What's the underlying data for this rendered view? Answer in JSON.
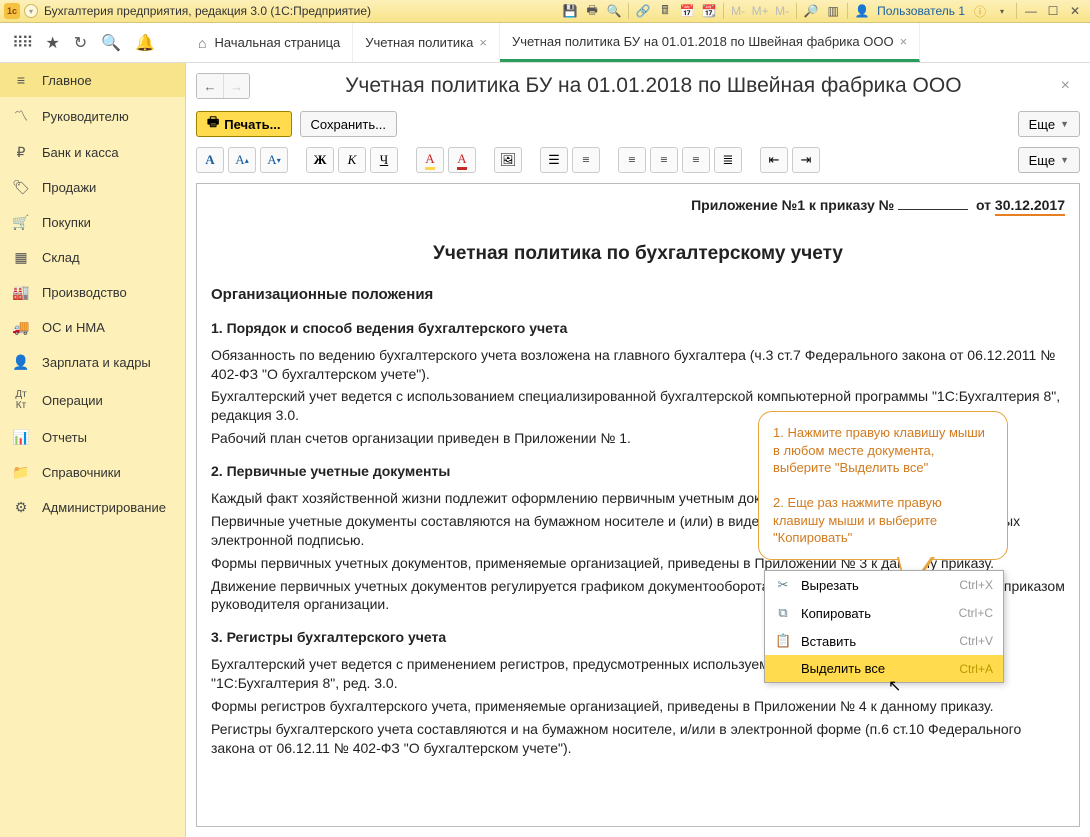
{
  "titlebar": {
    "title": "Бухгалтерия предприятия, редакция 3.0  (1С:Предприятие)",
    "user": "Пользователь 1"
  },
  "tabs": {
    "home": "Начальная страница",
    "t1": "Учетная политика",
    "t2": "Учетная политика БУ на 01.01.2018 по Швейная фабрика ООО"
  },
  "sidebar": {
    "items": [
      {
        "label": "Главное"
      },
      {
        "label": "Руководителю"
      },
      {
        "label": "Банк и касса"
      },
      {
        "label": "Продажи"
      },
      {
        "label": "Покупки"
      },
      {
        "label": "Склад"
      },
      {
        "label": "Производство"
      },
      {
        "label": "ОС и НМА"
      },
      {
        "label": "Зарплата и кадры"
      },
      {
        "label": "Операции"
      },
      {
        "label": "Отчеты"
      },
      {
        "label": "Справочники"
      },
      {
        "label": "Администрирование"
      }
    ]
  },
  "page": {
    "title": "Учетная политика БУ на 01.01.2018 по Швейная фабрика ООО",
    "print": "Печать...",
    "save": "Сохранить...",
    "more": "Еще"
  },
  "doc": {
    "annex_prefix": "Приложение №1 к приказу № ",
    "annex_from": "от ",
    "annex_date": "30.12.2017",
    "h2": "Учетная политика по бухгалтерскому учету",
    "h3_1": "Организационные положения",
    "h4_1": "1. Порядок и способ ведения бухгалтерского учета",
    "p1": "Обязанность по ведению бухгалтерского учета возложена на главного бухгалтера (ч.3 ст.7 Федерального закона от 06.12.2011 № 402-ФЗ \"О бухгалтерском учете\").",
    "p2": "Бухгалтерский учет ведется с использованием специализированной бухгалтерской компьютерной программы \"1С:Бухгалтерия 8\", редакция 3.0.",
    "p3": "Рабочий план счетов организации приведен в Приложении № 1.",
    "h4_2": "2. Первичные учетные документы",
    "p4": "Каждый факт хозяйственной жизни подлежит оформлению первичным учетным документом.",
    "p5": "Первичные учетные документы составляются на бумажном носителе и (или) в виде электронных документов, подписанных электронной подписью.",
    "p6": "Формы первичных учетных документов, применяемые организацией, приведены в Приложении № 3 к данному приказу.",
    "p7": "Движение первичных учетных документов регулируется графиком документооборота, который утверждается отдельным приказом руководителя организации.",
    "h4_3": "3. Регистры бухгалтерского учета",
    "p8": "Бухгалтерский учет ведется с применением регистров, предусмотренных используемой бухгалтерской программой \"1С:Бухгалтерия 8\", ред. 3.0.",
    "p9": "Формы регистров бухгалтерского учета, применяемые организацией, приведены в Приложении № 4 к данному приказу.",
    "p10": "Регистры бухгалтерского учета составляются и на бумажном носителе, и/или в электронной форме (п.6 ст.10 Федерального закона от 06.12.11 № 402-ФЗ \"О бухгалтерском учете\")."
  },
  "callout": {
    "l1": "1. Нажмите правую клавишу мыши в любом месте документа, выберите \"Выделить все\"",
    "l2": "2. Еще раз нажмите правую клавишу мыши и выберите \"Копировать\""
  },
  "ctx": {
    "cut": "Вырезать",
    "cut_k": "Ctrl+X",
    "copy": "Копировать",
    "copy_k": "Ctrl+C",
    "paste": "Вставить",
    "paste_k": "Ctrl+V",
    "selall": "Выделить все",
    "selall_k": "Ctrl+A"
  }
}
